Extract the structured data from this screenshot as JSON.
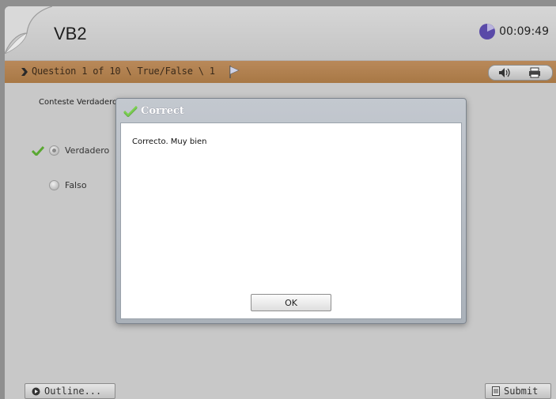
{
  "header": {
    "course_title": "VB2",
    "timer": "00:09:49"
  },
  "question_bar": {
    "info": "Question 1 of 10 \\ True/False \\ 1"
  },
  "question": {
    "instruction": "Conteste Verdadero o Falso",
    "options": [
      {
        "label": "Verdadero",
        "selected": true,
        "correct": true
      },
      {
        "label": "Falso",
        "selected": false
      }
    ]
  },
  "footer": {
    "outline_label": "Outline...",
    "submit_label": "Submit"
  },
  "dialog": {
    "title": "Correct",
    "message": "Correcto. Muy bien",
    "ok_label": "OK"
  },
  "colors": {
    "question_bar": "#ae7e4c",
    "timer_icon": "#5a4aa8",
    "check": "#5aa832"
  },
  "icons": [
    "page-curl-icon",
    "timer-icon",
    "arrow-icon",
    "flag-icon",
    "audio-icon",
    "print-icon",
    "check-icon",
    "outline-icon",
    "submit-icon"
  ]
}
